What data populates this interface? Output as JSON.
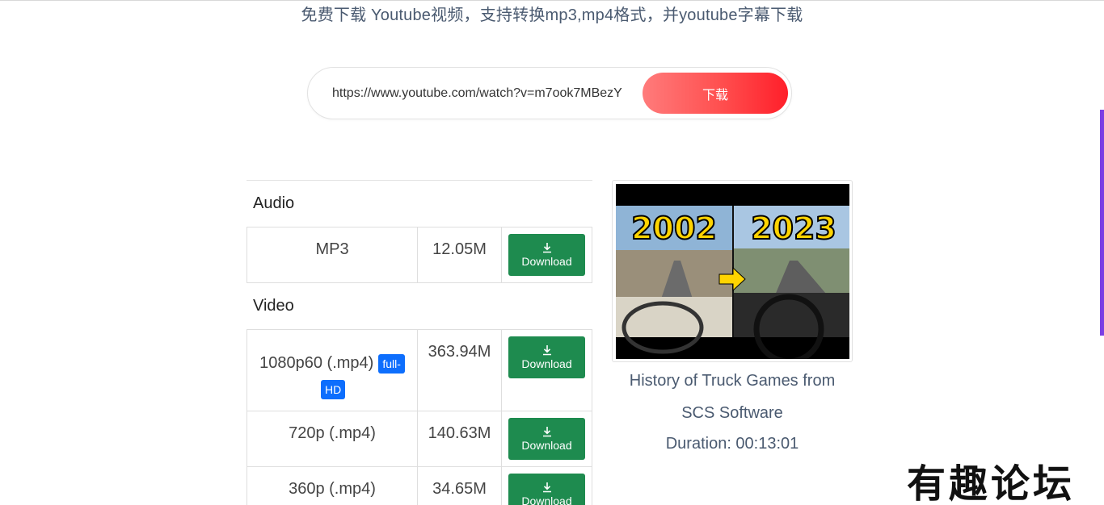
{
  "header": {
    "subtitle": "免费下载 Youtube视频，支持转换mp3,mp4格式，并youtube字幕下载"
  },
  "search": {
    "value": "https://www.youtube.com/watch?v=m7ook7MBezY",
    "button_label": "下载"
  },
  "audio": {
    "section_label": "Audio",
    "rows": [
      {
        "format": "MP3",
        "size": "12.05M",
        "button_label": "Download"
      }
    ]
  },
  "video": {
    "section_label": "Video",
    "rows": [
      {
        "format": "1080p60 (.mp4)",
        "badge_part1": "full-",
        "badge_part2": "HD",
        "size": "363.94M",
        "button_label": "Download"
      },
      {
        "format": "720p (.mp4)",
        "size": "140.63M",
        "button_label": "Download"
      },
      {
        "format": "360p (.mp4)",
        "size": "34.65M",
        "button_label": "Download"
      }
    ]
  },
  "video_info": {
    "thumbnail": {
      "left_year": "2002",
      "right_year": "2023"
    },
    "title_line1": "History of Truck Games from",
    "title_line2": "SCS Software",
    "duration": "Duration: 00:13:01"
  },
  "watermark": {
    "text": "有趣论坛"
  },
  "colors": {
    "accent_purple": "#7b3fe4",
    "download_green": "#1e8b4f",
    "badge_blue": "#0d6efd",
    "primary_red": "#ff1f2a"
  }
}
